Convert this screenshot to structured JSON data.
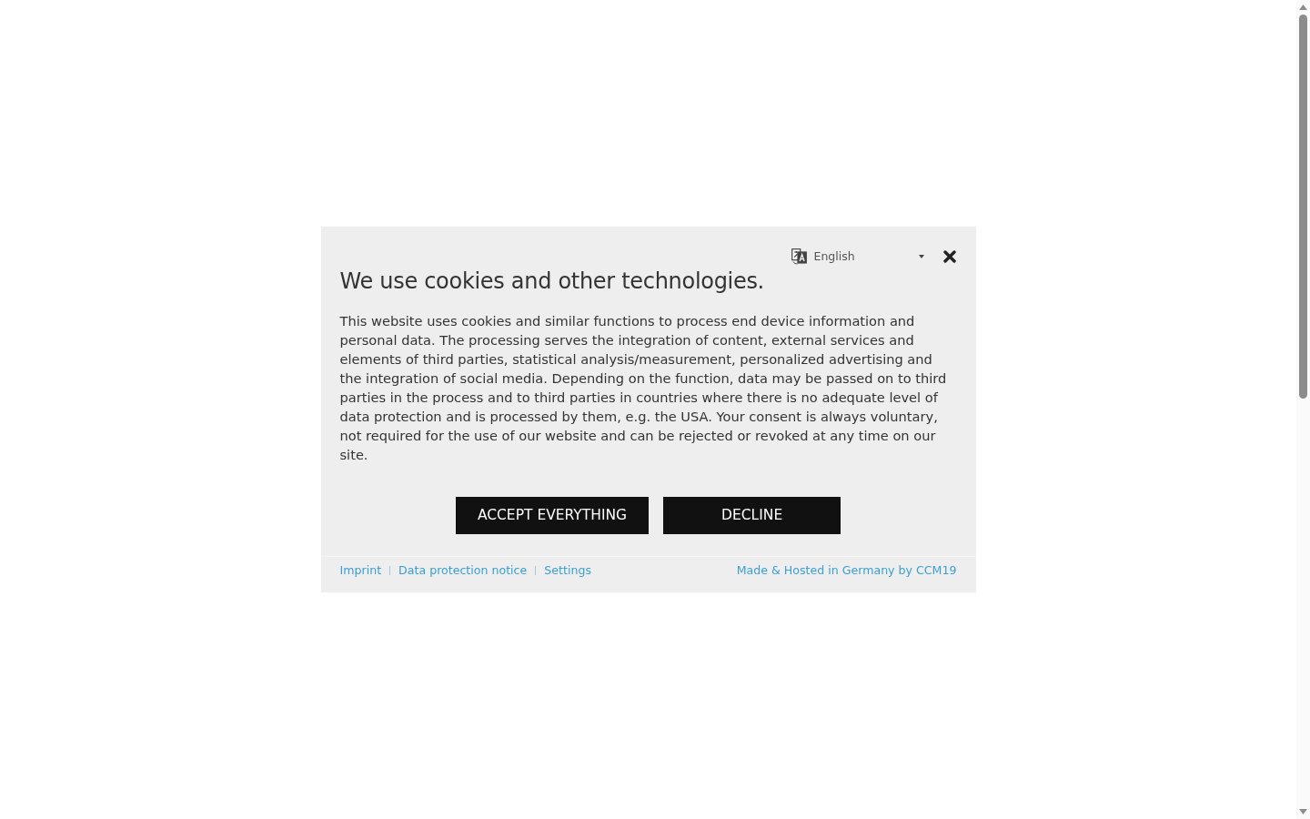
{
  "language_select": {
    "value": "English"
  },
  "title": "We use cookies and other technologies.",
  "body": "This website uses cookies and similar functions to process end device information and personal data. The processing serves the integration of content, external services and elements of third parties, statistical analysis/measurement, personalized advertising and the integration of social media. Depending on the function, data may be passed on to third parties in the process and to third parties in countries where there is no adequate level of data protection and is processed by them, e.g. the USA. Your consent is always voluntary, not required for the use of our website and can be rejected or revoked at any time on our site.",
  "buttons": [
    {
      "label": "ACCEPT EVERYTHING"
    },
    {
      "label": "DECLINE"
    }
  ],
  "footer_links": [
    "Imprint",
    "Data protection notice",
    "Settings"
  ],
  "credit": "Made & Hosted in Germany by CCM19"
}
